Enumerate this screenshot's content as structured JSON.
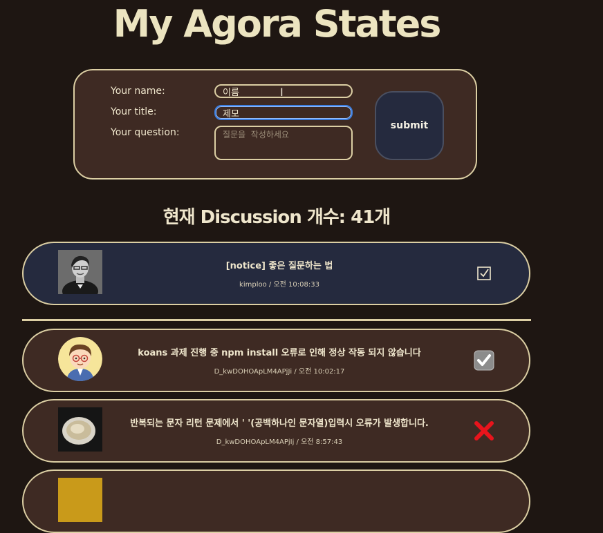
{
  "page": {
    "title": "My Agora States"
  },
  "form": {
    "name_label": "Your name:",
    "title_label": "Your title:",
    "question_label": "Your question:",
    "name_value": "이름",
    "title_value": "제모",
    "question_placeholder": "질문을  작성하세요",
    "submit_label": "submit"
  },
  "count": {
    "text": "현재 Discussion 개수: 41개"
  },
  "discussions": [
    {
      "title": "[notice] 좋은 질문하는 법",
      "meta": "kimploo / 오전 10:08:33",
      "status": "checkbox-outline",
      "avatar": "photo-person-icon"
    },
    {
      "title": "koans 과제 진행 중 npm install 오류로 인해 정상 작동 되지 않습니다",
      "meta": "D_kwDOHOApLM4APjJi / 오전 10:02:17",
      "status": "checked-box",
      "avatar": "cartoon-avatar-icon"
    },
    {
      "title": "반복되는 문자 리턴 문제에서 ' '(공백하나인 문자열)입력시 오류가 발생합니다.",
      "meta": "D_kwDOHOApLM4APjIj / 오전 8:57:43",
      "status": "cross",
      "avatar": "bowl-photo-icon"
    }
  ],
  "colors": {
    "background": "#1e1612",
    "card": "#3e2a23",
    "notice_card": "#252a3e",
    "border": "#dccfa4",
    "cross": "#e8141c"
  }
}
